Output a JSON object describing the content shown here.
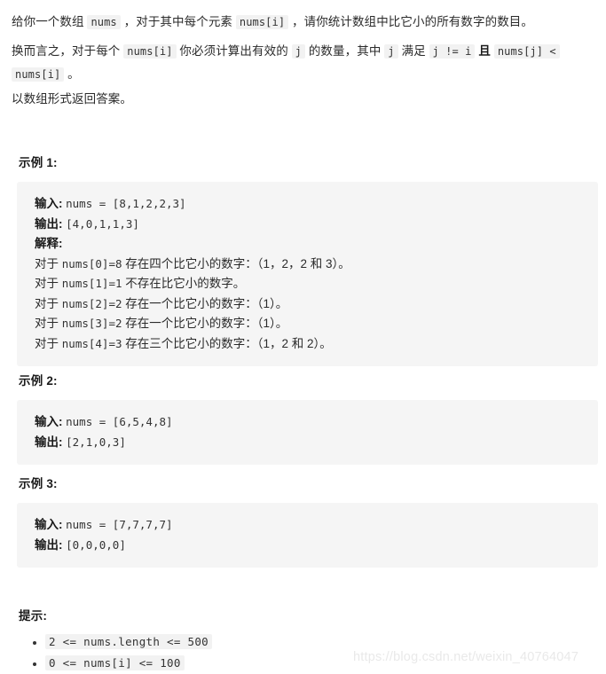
{
  "problem": {
    "paragraph1": {
      "seg1": "给你一个数组 ",
      "code1": "nums",
      "seg2": " ，对于其中每个元素 ",
      "code2": "nums[i]",
      "seg3": " ，请你统计数组中比它小的所有数字的数目。"
    },
    "paragraph2": {
      "seg1": "换而言之，对于每个 ",
      "code1": "nums[i]",
      "seg2": " 你必须计算出有效的 ",
      "code2": "j",
      "seg3": " 的数量，其中 ",
      "code3": "j",
      "seg4": " 满足 ",
      "code4": "j != i",
      "seg5": " ",
      "strong1": "且",
      "seg6": " ",
      "code5": "nums[j] <",
      "seg7": " ",
      "code6": "nums[i]",
      "seg8": " 。"
    },
    "paragraph3": "以数组形式返回答案。"
  },
  "examples": [
    {
      "heading": "示例 1:",
      "rows": [
        {
          "label": "输入:",
          "value": "nums = [8,1,2,2,3]",
          "type": "mono"
        },
        {
          "label": "输出:",
          "value": "[4,0,1,1,3]",
          "type": "mono"
        },
        {
          "label": "解释:",
          "value": "",
          "type": "mono"
        }
      ],
      "explanations": [
        {
          "prefix": "对于 ",
          "code": "nums[0]=8",
          "text": " 存在四个比它小的数字：（1，2，2 和 3）。"
        },
        {
          "prefix": "对于 ",
          "code": "nums[1]=1",
          "text": " 不存在比它小的数字。"
        },
        {
          "prefix": "对于 ",
          "code": "nums[2]=2",
          "text": " 存在一个比它小的数字：（1）。"
        },
        {
          "prefix": "对于 ",
          "code": "nums[3]=2",
          "text": " 存在一个比它小的数字：（1）。"
        },
        {
          "prefix": "对于 ",
          "code": "nums[4]=3",
          "text": " 存在三个比它小的数字：（1，2 和 2）。"
        }
      ]
    },
    {
      "heading": "示例 2:",
      "rows": [
        {
          "label": "输入:",
          "value": "nums = [6,5,4,8]",
          "type": "mono"
        },
        {
          "label": "输出:",
          "value": "[2,1,0,3]",
          "type": "mono"
        }
      ],
      "explanations": []
    },
    {
      "heading": "示例 3:",
      "rows": [
        {
          "label": "输入:",
          "value": "nums = [7,7,7,7]",
          "type": "mono"
        },
        {
          "label": "输出:",
          "value": "[0,0,0,0]",
          "type": "mono"
        }
      ],
      "explanations": []
    }
  ],
  "hints": {
    "heading": "提示:",
    "items": [
      "2 <= nums.length <= 500",
      "0 <= nums[i] <= 100"
    ]
  },
  "watermark": "https://blog.csdn.net/weixin_40764047",
  "colors": {
    "text": "#2b2b2b",
    "heading": "#1a1a1a",
    "code_bg": "#f2f2f2",
    "pre_bg": "#f5f5f5",
    "watermark": "#e9e9e9",
    "page_bg": "#ffffff"
  }
}
